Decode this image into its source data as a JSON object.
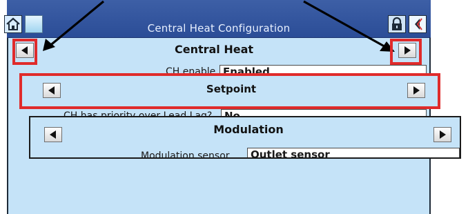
{
  "window": {
    "title": "Central Heat Configuration"
  },
  "icons": {
    "home": "home-icon",
    "page": "page-icon",
    "lock": "lock-icon",
    "back": "back-icon"
  },
  "central_heat": {
    "label": "Central Heat",
    "field_label": "CH enable",
    "field_value": "Enabled"
  },
  "setpoint": {
    "label": "Setpoint",
    "field_label": "CH has priority over Lead Lag?",
    "field_value": "No"
  },
  "modulation": {
    "label": "Modulation",
    "field_label": "Modulation sensor",
    "field_value": "Outlet sensor"
  },
  "colors": {
    "highlight": "#e02b2b",
    "titlebar": "#2b4d97",
    "screen": "#c5e3f8"
  }
}
